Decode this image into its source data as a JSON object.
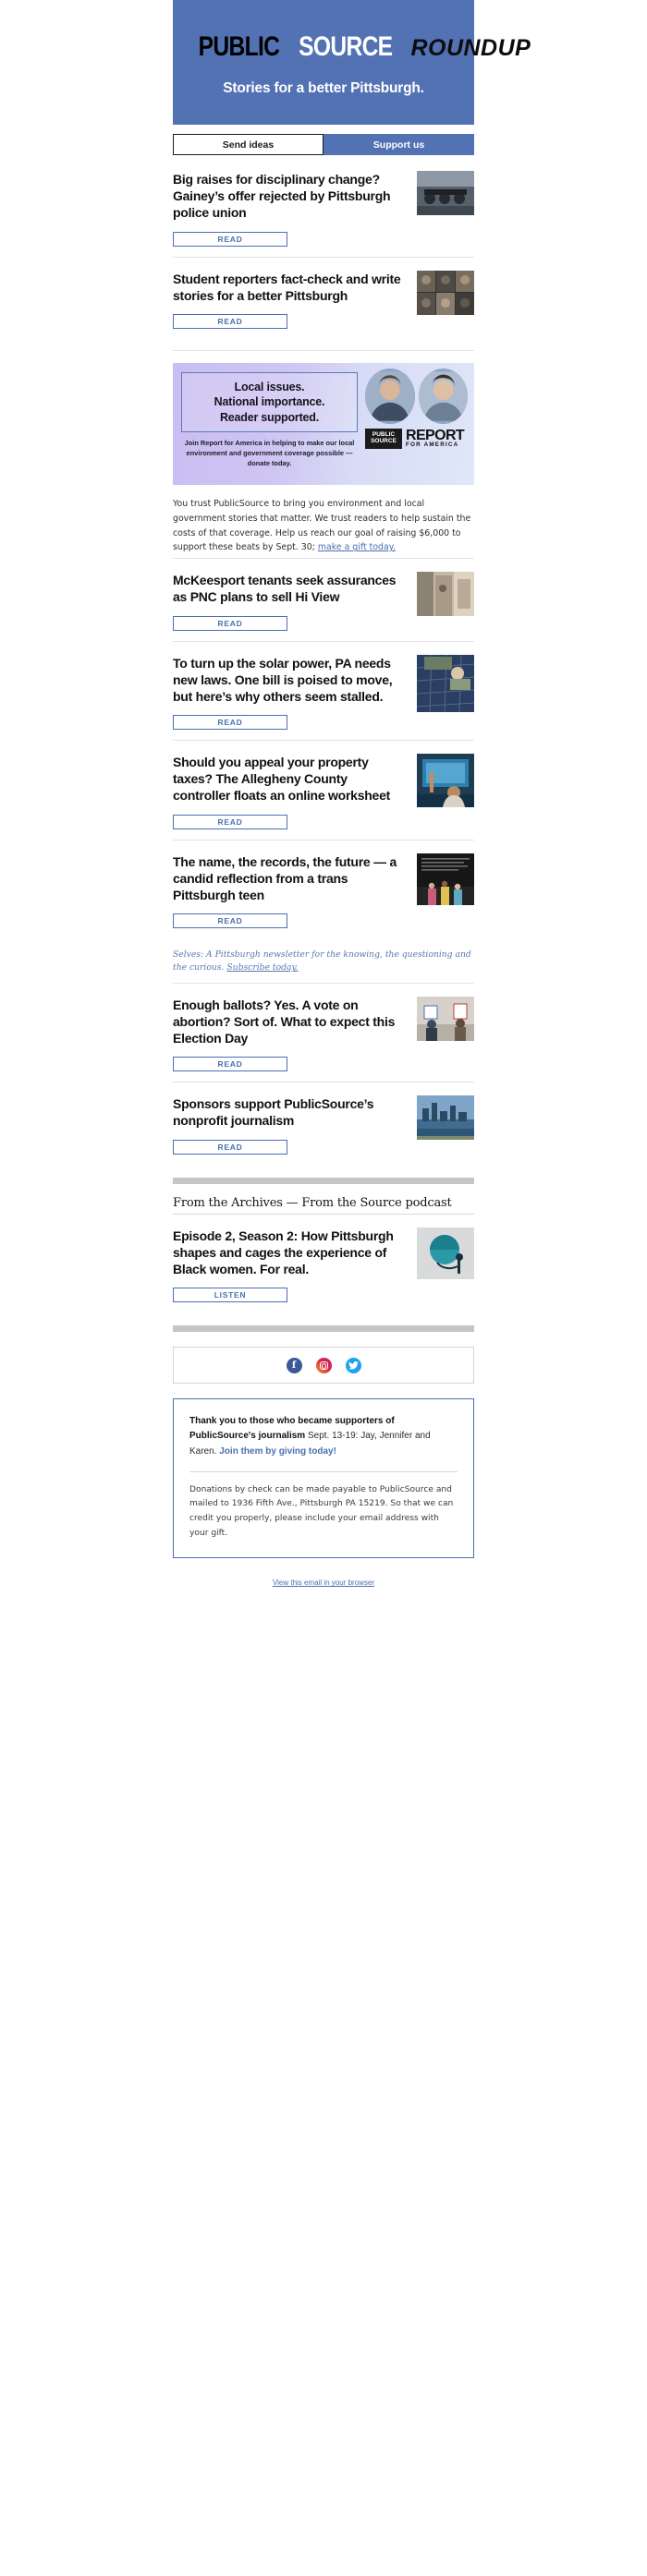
{
  "header": {
    "logo_public": "PUBLIC",
    "logo_source": "SOURCE",
    "logo_roundup": "ROUNDUP",
    "tagline": "Stories for a better Pittsburgh.",
    "bg_color": "#5272b4"
  },
  "cta": {
    "send_ideas": "Send ideas",
    "support_us": "Support us"
  },
  "read_label": "READ",
  "listen_label": "LISTEN",
  "stories": [
    {
      "headline": "Big raises for disciplinary change? Gainey’s offer rejected by Pittsburgh police union",
      "cta": "READ",
      "image": "police-motorcycles"
    },
    {
      "headline": "Student reporters fact-check and write stories for a better Pittsburgh",
      "cta": "READ",
      "image": "student-portrait-grid"
    },
    {
      "headline": "McKeesport tenants seek assurances as PNC plans to sell Hi View",
      "cta": "READ",
      "image": "apartment-hallway"
    },
    {
      "headline": "To turn up the solar power, PA needs new laws. One bill is poised to move, but here’s why others seem stalled.",
      "cta": "READ",
      "image": "solar-panel-installer"
    },
    {
      "headline": "Should you appeal your property taxes? The Allegheny County controller floats an online worksheet",
      "cta": "READ",
      "image": "presenter-at-screen"
    },
    {
      "headline": "The name, the records, the future — a candid reflection from a trans Pittsburgh teen",
      "cta": "READ",
      "image": "teen-illustration-dark"
    },
    {
      "headline": "Enough ballots? Yes. A vote on abortion? Sort of. What to expect this Election Day",
      "cta": "READ",
      "image": "voters-with-signs"
    },
    {
      "headline": "Sponsors support PublicSource’s nonprofit journalism",
      "cta": "READ",
      "image": "pittsburgh-skyline"
    }
  ],
  "promo": {
    "line1": "Local issues.",
    "line2": "National importance.",
    "line3": "Reader supported.",
    "sub": "Join Report for America in helping to make our local environment and government coverage possible — donate today.",
    "rfa_mark_line1": "PUBLIC",
    "rfa_mark_line2": "SOURCE",
    "rfa_word_main": "REPORT",
    "rfa_word_sub": "FOR AMERICA"
  },
  "support_paragraph": {
    "text_before": "You trust PublicSource to bring you environment and local government stories that matter. We trust readers to help sustain the costs of that coverage. Help us reach our goal of raising $6,000 to support these beats by Sept. 30; ",
    "link": "make a gift today."
  },
  "selves_promo": {
    "line": "Selves: A Pittsburgh newsletter for the knowing, the questioning and the curious. ",
    "link": "Subscribe today."
  },
  "archives": {
    "section_title": "From the Archives — From the Source podcast",
    "episode_headline": "Episode 2, Season 2: How Pittsburgh shapes and cages the experience of Black women. For real.",
    "cta": "LISTEN",
    "image": "podcast-artwork"
  },
  "social": {
    "facebook": "f",
    "instagram": "instagram-icon",
    "twitter": "twitter-icon"
  },
  "thank_you": {
    "bold_part": "Thank you to those who became supporters of PublicSource's journalism",
    "mid_part": " Sept. 13-19: Jay, Jennifer and Karen. ",
    "link": "Join them by giving today!",
    "body": "Donations by check can be made payable to PublicSource and mailed to 1936 Fifth Ave., Pittsburgh PA 15219. So that we can credit you properly, please include your email address with your gift."
  },
  "footer": {
    "view_in_browser": "View this email in your browser"
  }
}
